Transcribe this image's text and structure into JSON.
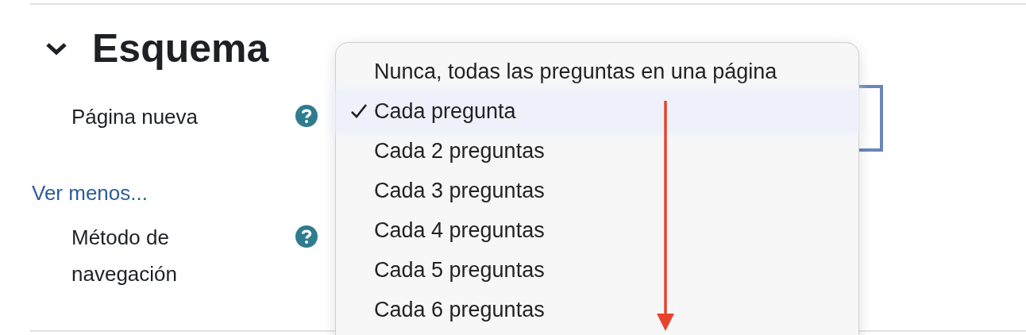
{
  "section": {
    "title": "Esquema",
    "expanded": true
  },
  "fields": [
    {
      "kind": "field",
      "label": "Página nueva"
    },
    {
      "kind": "link",
      "label": "Ver menos..."
    },
    {
      "kind": "field",
      "label": "Método de navegación"
    }
  ],
  "dropdown": {
    "options": [
      {
        "label": "Nunca, todas las preguntas en una página",
        "selected": false
      },
      {
        "label": "Cada pregunta",
        "selected": true
      },
      {
        "label": "Cada 2 preguntas",
        "selected": false
      },
      {
        "label": "Cada 3 preguntas",
        "selected": false
      },
      {
        "label": "Cada 4 preguntas",
        "selected": false
      },
      {
        "label": "Cada 5 preguntas",
        "selected": false
      },
      {
        "label": "Cada 6 preguntas",
        "selected": false
      }
    ]
  }
}
